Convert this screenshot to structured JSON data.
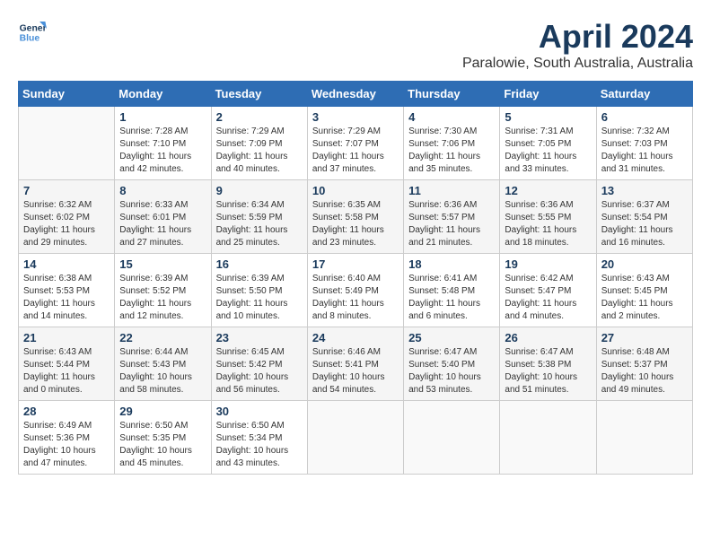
{
  "header": {
    "logo": {
      "line1": "General",
      "line2": "Blue"
    },
    "month": "April 2024",
    "location": "Paralowie, South Australia, Australia"
  },
  "weekdays": [
    "Sunday",
    "Monday",
    "Tuesday",
    "Wednesday",
    "Thursday",
    "Friday",
    "Saturday"
  ],
  "weeks": [
    [
      {
        "day": "",
        "info": ""
      },
      {
        "day": "1",
        "info": "Sunrise: 7:28 AM\nSunset: 7:10 PM\nDaylight: 11 hours\nand 42 minutes."
      },
      {
        "day": "2",
        "info": "Sunrise: 7:29 AM\nSunset: 7:09 PM\nDaylight: 11 hours\nand 40 minutes."
      },
      {
        "day": "3",
        "info": "Sunrise: 7:29 AM\nSunset: 7:07 PM\nDaylight: 11 hours\nand 37 minutes."
      },
      {
        "day": "4",
        "info": "Sunrise: 7:30 AM\nSunset: 7:06 PM\nDaylight: 11 hours\nand 35 minutes."
      },
      {
        "day": "5",
        "info": "Sunrise: 7:31 AM\nSunset: 7:05 PM\nDaylight: 11 hours\nand 33 minutes."
      },
      {
        "day": "6",
        "info": "Sunrise: 7:32 AM\nSunset: 7:03 PM\nDaylight: 11 hours\nand 31 minutes."
      }
    ],
    [
      {
        "day": "7",
        "info": "Sunrise: 6:32 AM\nSunset: 6:02 PM\nDaylight: 11 hours\nand 29 minutes."
      },
      {
        "day": "8",
        "info": "Sunrise: 6:33 AM\nSunset: 6:01 PM\nDaylight: 11 hours\nand 27 minutes."
      },
      {
        "day": "9",
        "info": "Sunrise: 6:34 AM\nSunset: 5:59 PM\nDaylight: 11 hours\nand 25 minutes."
      },
      {
        "day": "10",
        "info": "Sunrise: 6:35 AM\nSunset: 5:58 PM\nDaylight: 11 hours\nand 23 minutes."
      },
      {
        "day": "11",
        "info": "Sunrise: 6:36 AM\nSunset: 5:57 PM\nDaylight: 11 hours\nand 21 minutes."
      },
      {
        "day": "12",
        "info": "Sunrise: 6:36 AM\nSunset: 5:55 PM\nDaylight: 11 hours\nand 18 minutes."
      },
      {
        "day": "13",
        "info": "Sunrise: 6:37 AM\nSunset: 5:54 PM\nDaylight: 11 hours\nand 16 minutes."
      }
    ],
    [
      {
        "day": "14",
        "info": "Sunrise: 6:38 AM\nSunset: 5:53 PM\nDaylight: 11 hours\nand 14 minutes."
      },
      {
        "day": "15",
        "info": "Sunrise: 6:39 AM\nSunset: 5:52 PM\nDaylight: 11 hours\nand 12 minutes."
      },
      {
        "day": "16",
        "info": "Sunrise: 6:39 AM\nSunset: 5:50 PM\nDaylight: 11 hours\nand 10 minutes."
      },
      {
        "day": "17",
        "info": "Sunrise: 6:40 AM\nSunset: 5:49 PM\nDaylight: 11 hours\nand 8 minutes."
      },
      {
        "day": "18",
        "info": "Sunrise: 6:41 AM\nSunset: 5:48 PM\nDaylight: 11 hours\nand 6 minutes."
      },
      {
        "day": "19",
        "info": "Sunrise: 6:42 AM\nSunset: 5:47 PM\nDaylight: 11 hours\nand 4 minutes."
      },
      {
        "day": "20",
        "info": "Sunrise: 6:43 AM\nSunset: 5:45 PM\nDaylight: 11 hours\nand 2 minutes."
      }
    ],
    [
      {
        "day": "21",
        "info": "Sunrise: 6:43 AM\nSunset: 5:44 PM\nDaylight: 11 hours\nand 0 minutes."
      },
      {
        "day": "22",
        "info": "Sunrise: 6:44 AM\nSunset: 5:43 PM\nDaylight: 10 hours\nand 58 minutes."
      },
      {
        "day": "23",
        "info": "Sunrise: 6:45 AM\nSunset: 5:42 PM\nDaylight: 10 hours\nand 56 minutes."
      },
      {
        "day": "24",
        "info": "Sunrise: 6:46 AM\nSunset: 5:41 PM\nDaylight: 10 hours\nand 54 minutes."
      },
      {
        "day": "25",
        "info": "Sunrise: 6:47 AM\nSunset: 5:40 PM\nDaylight: 10 hours\nand 53 minutes."
      },
      {
        "day": "26",
        "info": "Sunrise: 6:47 AM\nSunset: 5:38 PM\nDaylight: 10 hours\nand 51 minutes."
      },
      {
        "day": "27",
        "info": "Sunrise: 6:48 AM\nSunset: 5:37 PM\nDaylight: 10 hours\nand 49 minutes."
      }
    ],
    [
      {
        "day": "28",
        "info": "Sunrise: 6:49 AM\nSunset: 5:36 PM\nDaylight: 10 hours\nand 47 minutes."
      },
      {
        "day": "29",
        "info": "Sunrise: 6:50 AM\nSunset: 5:35 PM\nDaylight: 10 hours\nand 45 minutes."
      },
      {
        "day": "30",
        "info": "Sunrise: 6:50 AM\nSunset: 5:34 PM\nDaylight: 10 hours\nand 43 minutes."
      },
      {
        "day": "",
        "info": ""
      },
      {
        "day": "",
        "info": ""
      },
      {
        "day": "",
        "info": ""
      },
      {
        "day": "",
        "info": ""
      }
    ]
  ]
}
